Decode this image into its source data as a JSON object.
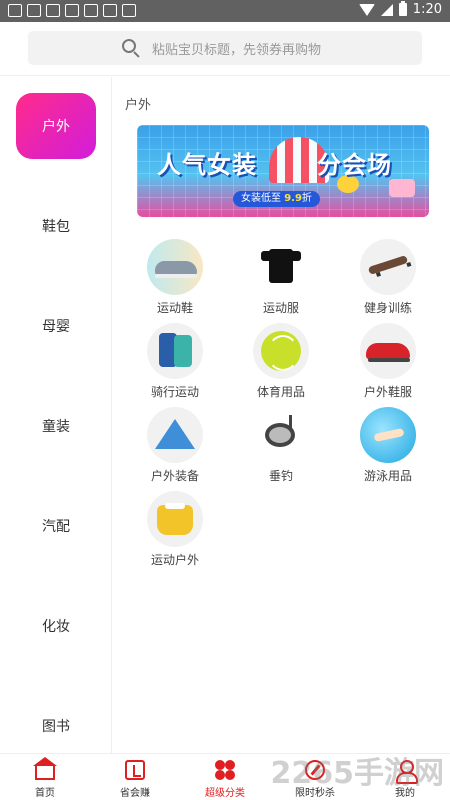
{
  "status_bar": {
    "time": "1:20"
  },
  "search": {
    "placeholder": "粘贴宝贝标题，先领券再购物"
  },
  "sidebar": {
    "items": [
      {
        "label": "户外",
        "active": true
      },
      {
        "label": "鞋包"
      },
      {
        "label": "母婴"
      },
      {
        "label": "童装"
      },
      {
        "label": "汽配"
      },
      {
        "label": "化妆"
      },
      {
        "label": "图书"
      }
    ]
  },
  "content": {
    "section_title": "户外",
    "banner": {
      "title_left": "人气女装",
      "title_right": "分会场",
      "tag_prefix": "女装低至",
      "tag_value": "9.9",
      "tag_suffix": "折"
    },
    "categories": [
      {
        "label": "运动鞋",
        "icon": "running-shoe-icon"
      },
      {
        "label": "运动服",
        "icon": "tshirt-icon"
      },
      {
        "label": "健身训练",
        "icon": "skateboard-icon"
      },
      {
        "label": "骑行运动",
        "icon": "jacket-icon"
      },
      {
        "label": "体育用品",
        "icon": "tennis-ball-icon"
      },
      {
        "label": "户外鞋服",
        "icon": "sneaker-icon"
      },
      {
        "label": "户外装备",
        "icon": "tent-icon"
      },
      {
        "label": "垂钓",
        "icon": "fishing-reel-icon"
      },
      {
        "label": "游泳用品",
        "icon": "swimming-icon"
      },
      {
        "label": "运动户外",
        "icon": "blouse-icon"
      }
    ]
  },
  "tabbar": {
    "items": [
      {
        "label": "首页"
      },
      {
        "label": "省会赚"
      },
      {
        "label": "超级分类",
        "active": true
      },
      {
        "label": "限时秒杀"
      },
      {
        "label": "我的"
      }
    ]
  },
  "watermark": "2265手游网",
  "colors": {
    "accent": "#e02020",
    "active_gradient_start": "#ff2b8a",
    "active_gradient_end": "#d21ddc"
  }
}
